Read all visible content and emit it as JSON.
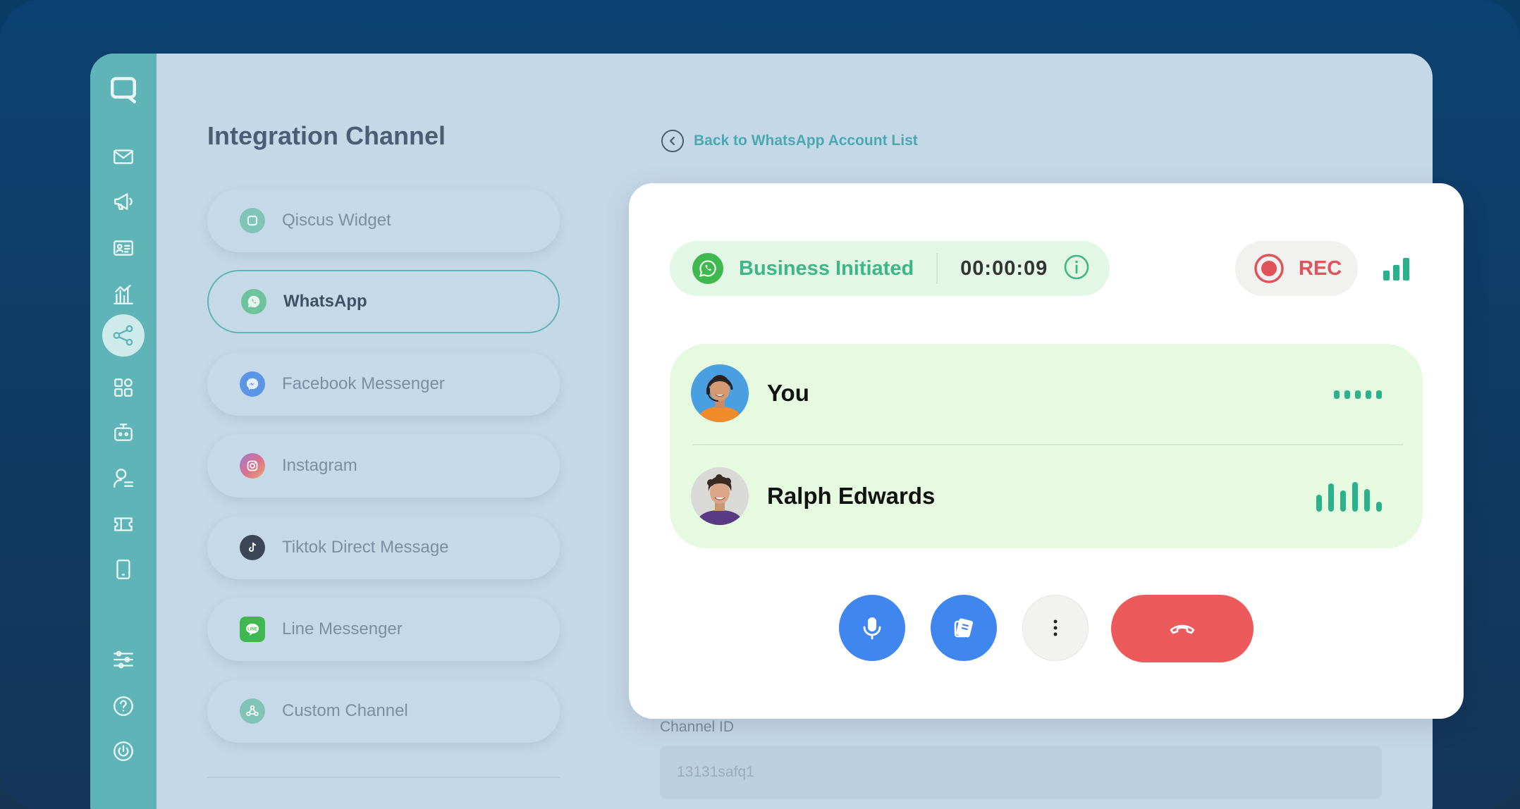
{
  "sidebar": {
    "items": [
      {
        "icon": "chat-logo-icon"
      },
      {
        "icon": "mail-icon"
      },
      {
        "icon": "megaphone-icon"
      },
      {
        "icon": "contact-card-icon"
      },
      {
        "icon": "analytics-icon"
      },
      {
        "icon": "integration-share-icon",
        "active": true
      },
      {
        "icon": "apps-grid-icon"
      },
      {
        "icon": "bot-icon"
      },
      {
        "icon": "agent-icon"
      },
      {
        "icon": "ticket-icon"
      },
      {
        "icon": "mobile-icon"
      },
      {
        "icon": "settings-sliders-icon"
      },
      {
        "icon": "help-icon"
      },
      {
        "icon": "power-icon"
      }
    ]
  },
  "integration": {
    "title": "Integration Channel",
    "channels": [
      {
        "label": "Qiscus Widget",
        "icon": "qiscus-icon"
      },
      {
        "label": "WhatsApp",
        "icon": "whatsapp-icon",
        "active": true
      },
      {
        "label": "Facebook Messenger",
        "icon": "messenger-icon"
      },
      {
        "label": "Instagram",
        "icon": "instagram-icon"
      },
      {
        "label": "Tiktok Direct Message",
        "icon": "tiktok-icon"
      },
      {
        "label": "Line Messenger",
        "icon": "line-icon"
      },
      {
        "label": "Custom Channel",
        "icon": "custom-channel-icon"
      }
    ]
  },
  "detail": {
    "back_label": "Back to WhatsApp Account List",
    "channel_id_label": "Channel ID",
    "channel_id_value": "13131safq1"
  },
  "call": {
    "status_label": "Business Initiated",
    "timer": "00:00:09",
    "rec_label": "REC",
    "participants": [
      {
        "name": "You"
      },
      {
        "name": "Ralph Edwards"
      }
    ]
  },
  "colors": {
    "accent": "#5fb4b8",
    "whatsapp_green": "#3fb94f",
    "status_text": "#3fb588",
    "control_blue": "#3f86ee",
    "hangup_red": "#ec5a5c",
    "rec_red": "#e0535a"
  }
}
